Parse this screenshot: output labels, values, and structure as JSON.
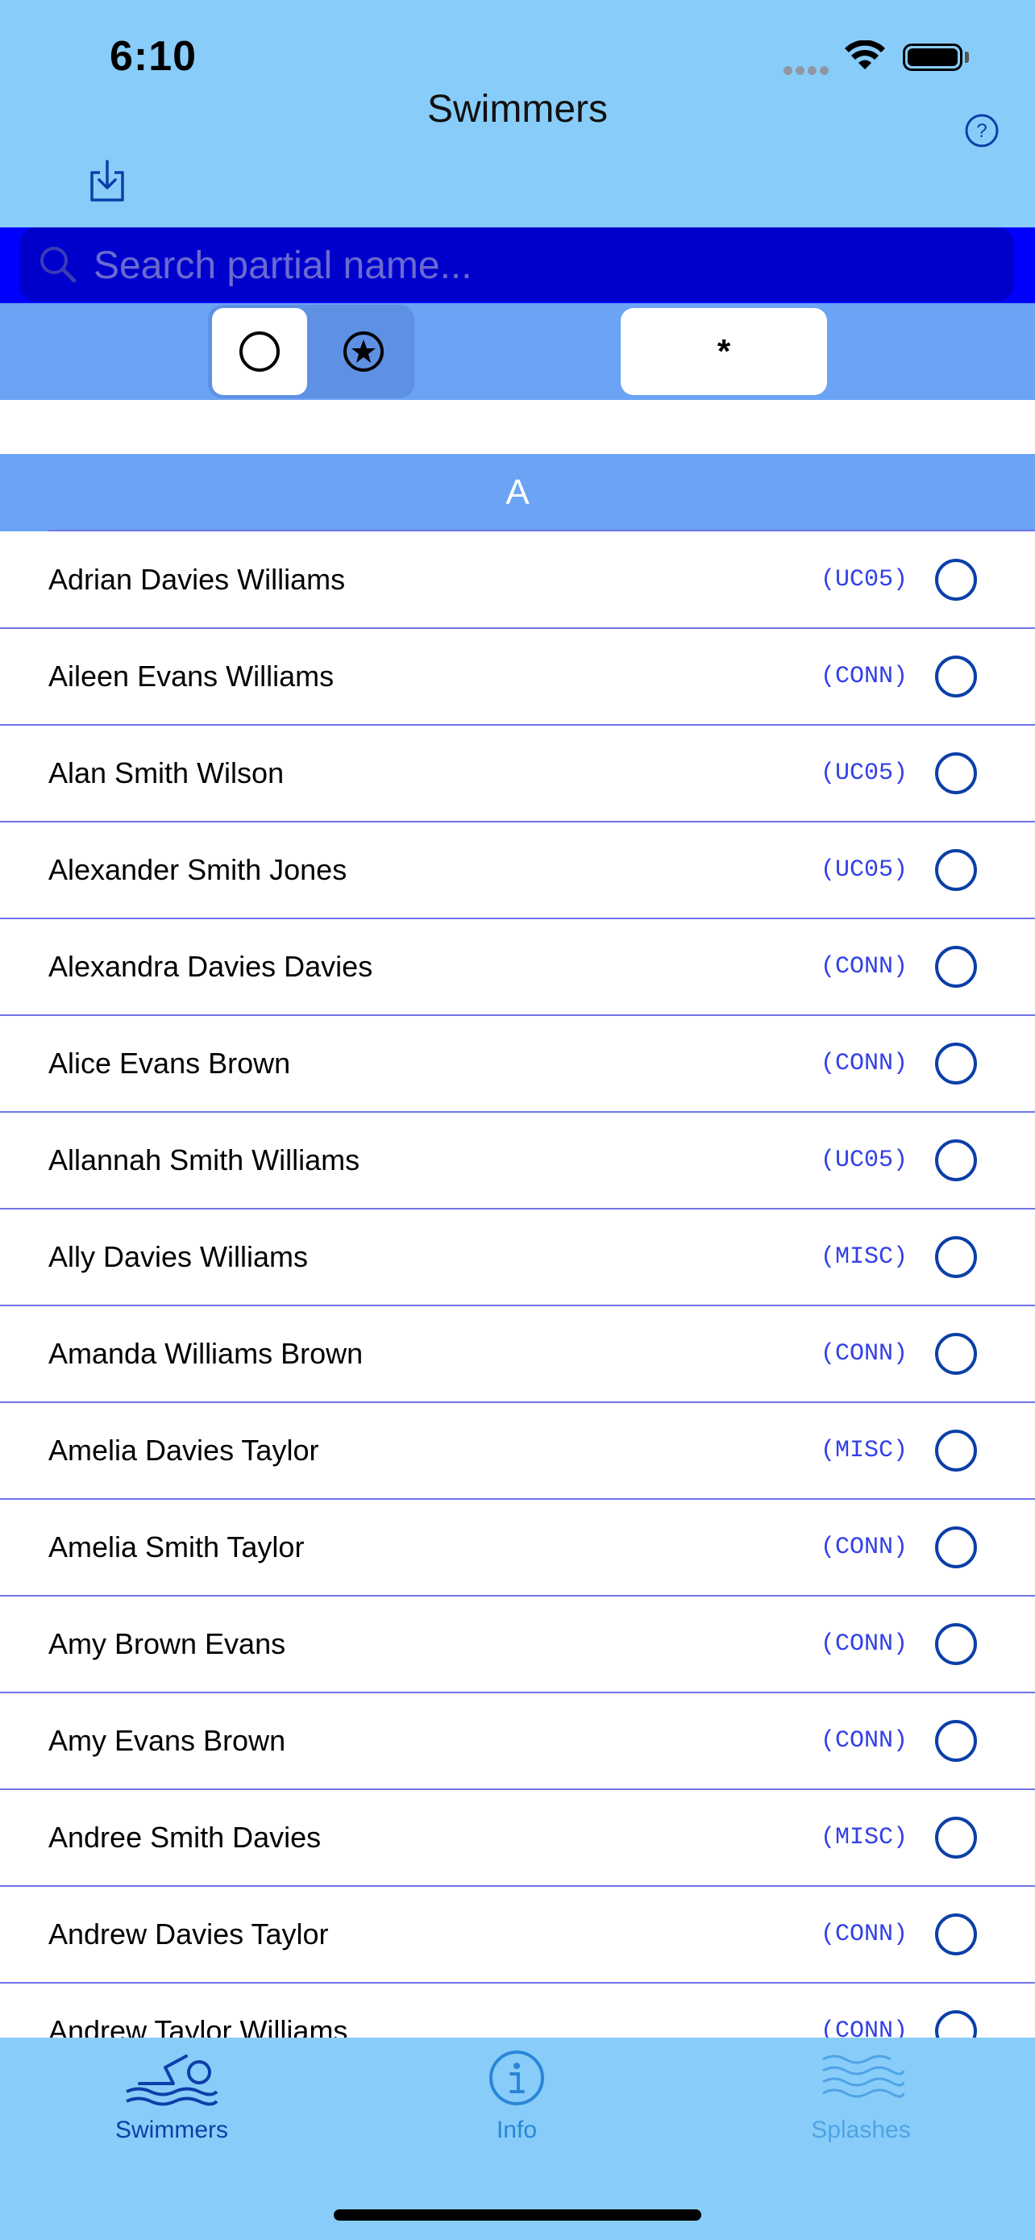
{
  "status_bar": {
    "time": "6:10"
  },
  "nav": {
    "title": "Swimmers"
  },
  "search": {
    "placeholder": "Search partial name..."
  },
  "filter": {
    "group_field": "*"
  },
  "section": {
    "letter": "A"
  },
  "swimmers": [
    {
      "name": "Adrian Davies Williams",
      "club": "(UC05)"
    },
    {
      "name": "Aileen Evans Williams",
      "club": "(CONN)"
    },
    {
      "name": "Alan Smith Wilson",
      "club": "(UC05)"
    },
    {
      "name": "Alexander Smith Jones",
      "club": "(UC05)"
    },
    {
      "name": "Alexandra Davies Davies",
      "club": "(CONN)"
    },
    {
      "name": "Alice Evans Brown",
      "club": "(CONN)"
    },
    {
      "name": "Allannah Smith Williams",
      "club": "(UC05)"
    },
    {
      "name": "Ally Davies Williams",
      "club": "(MISC)"
    },
    {
      "name": "Amanda Williams Brown",
      "club": "(CONN)"
    },
    {
      "name": "Amelia Davies Taylor",
      "club": "(MISC)"
    },
    {
      "name": "Amelia Smith Taylor",
      "club": "(CONN)"
    },
    {
      "name": "Amy Brown Evans",
      "club": "(CONN)"
    },
    {
      "name": "Amy Evans Brown",
      "club": "(CONN)"
    },
    {
      "name": "Andree Smith Davies",
      "club": "(MISC)"
    },
    {
      "name": "Andrew Davies Taylor",
      "club": "(CONN)"
    },
    {
      "name": "Andrew Taylor Williams",
      "club": "(CONN)"
    }
  ],
  "tabs": [
    {
      "label": "Swimmers",
      "icon": "swimmer-icon",
      "color": "#0b3fa8"
    },
    {
      "label": "Info",
      "icon": "info-icon",
      "color": "#2a86d8"
    },
    {
      "label": "Splashes",
      "icon": "waves-icon",
      "color": "#4fa3e6"
    }
  ],
  "colors": {
    "header_bg": "#88cdf9",
    "search_bg": "#0000ff",
    "filter_bg": "#6ba3f5",
    "separator": "#6f75e8",
    "club_text": "#3240e6",
    "accent": "#0b3fa8"
  }
}
